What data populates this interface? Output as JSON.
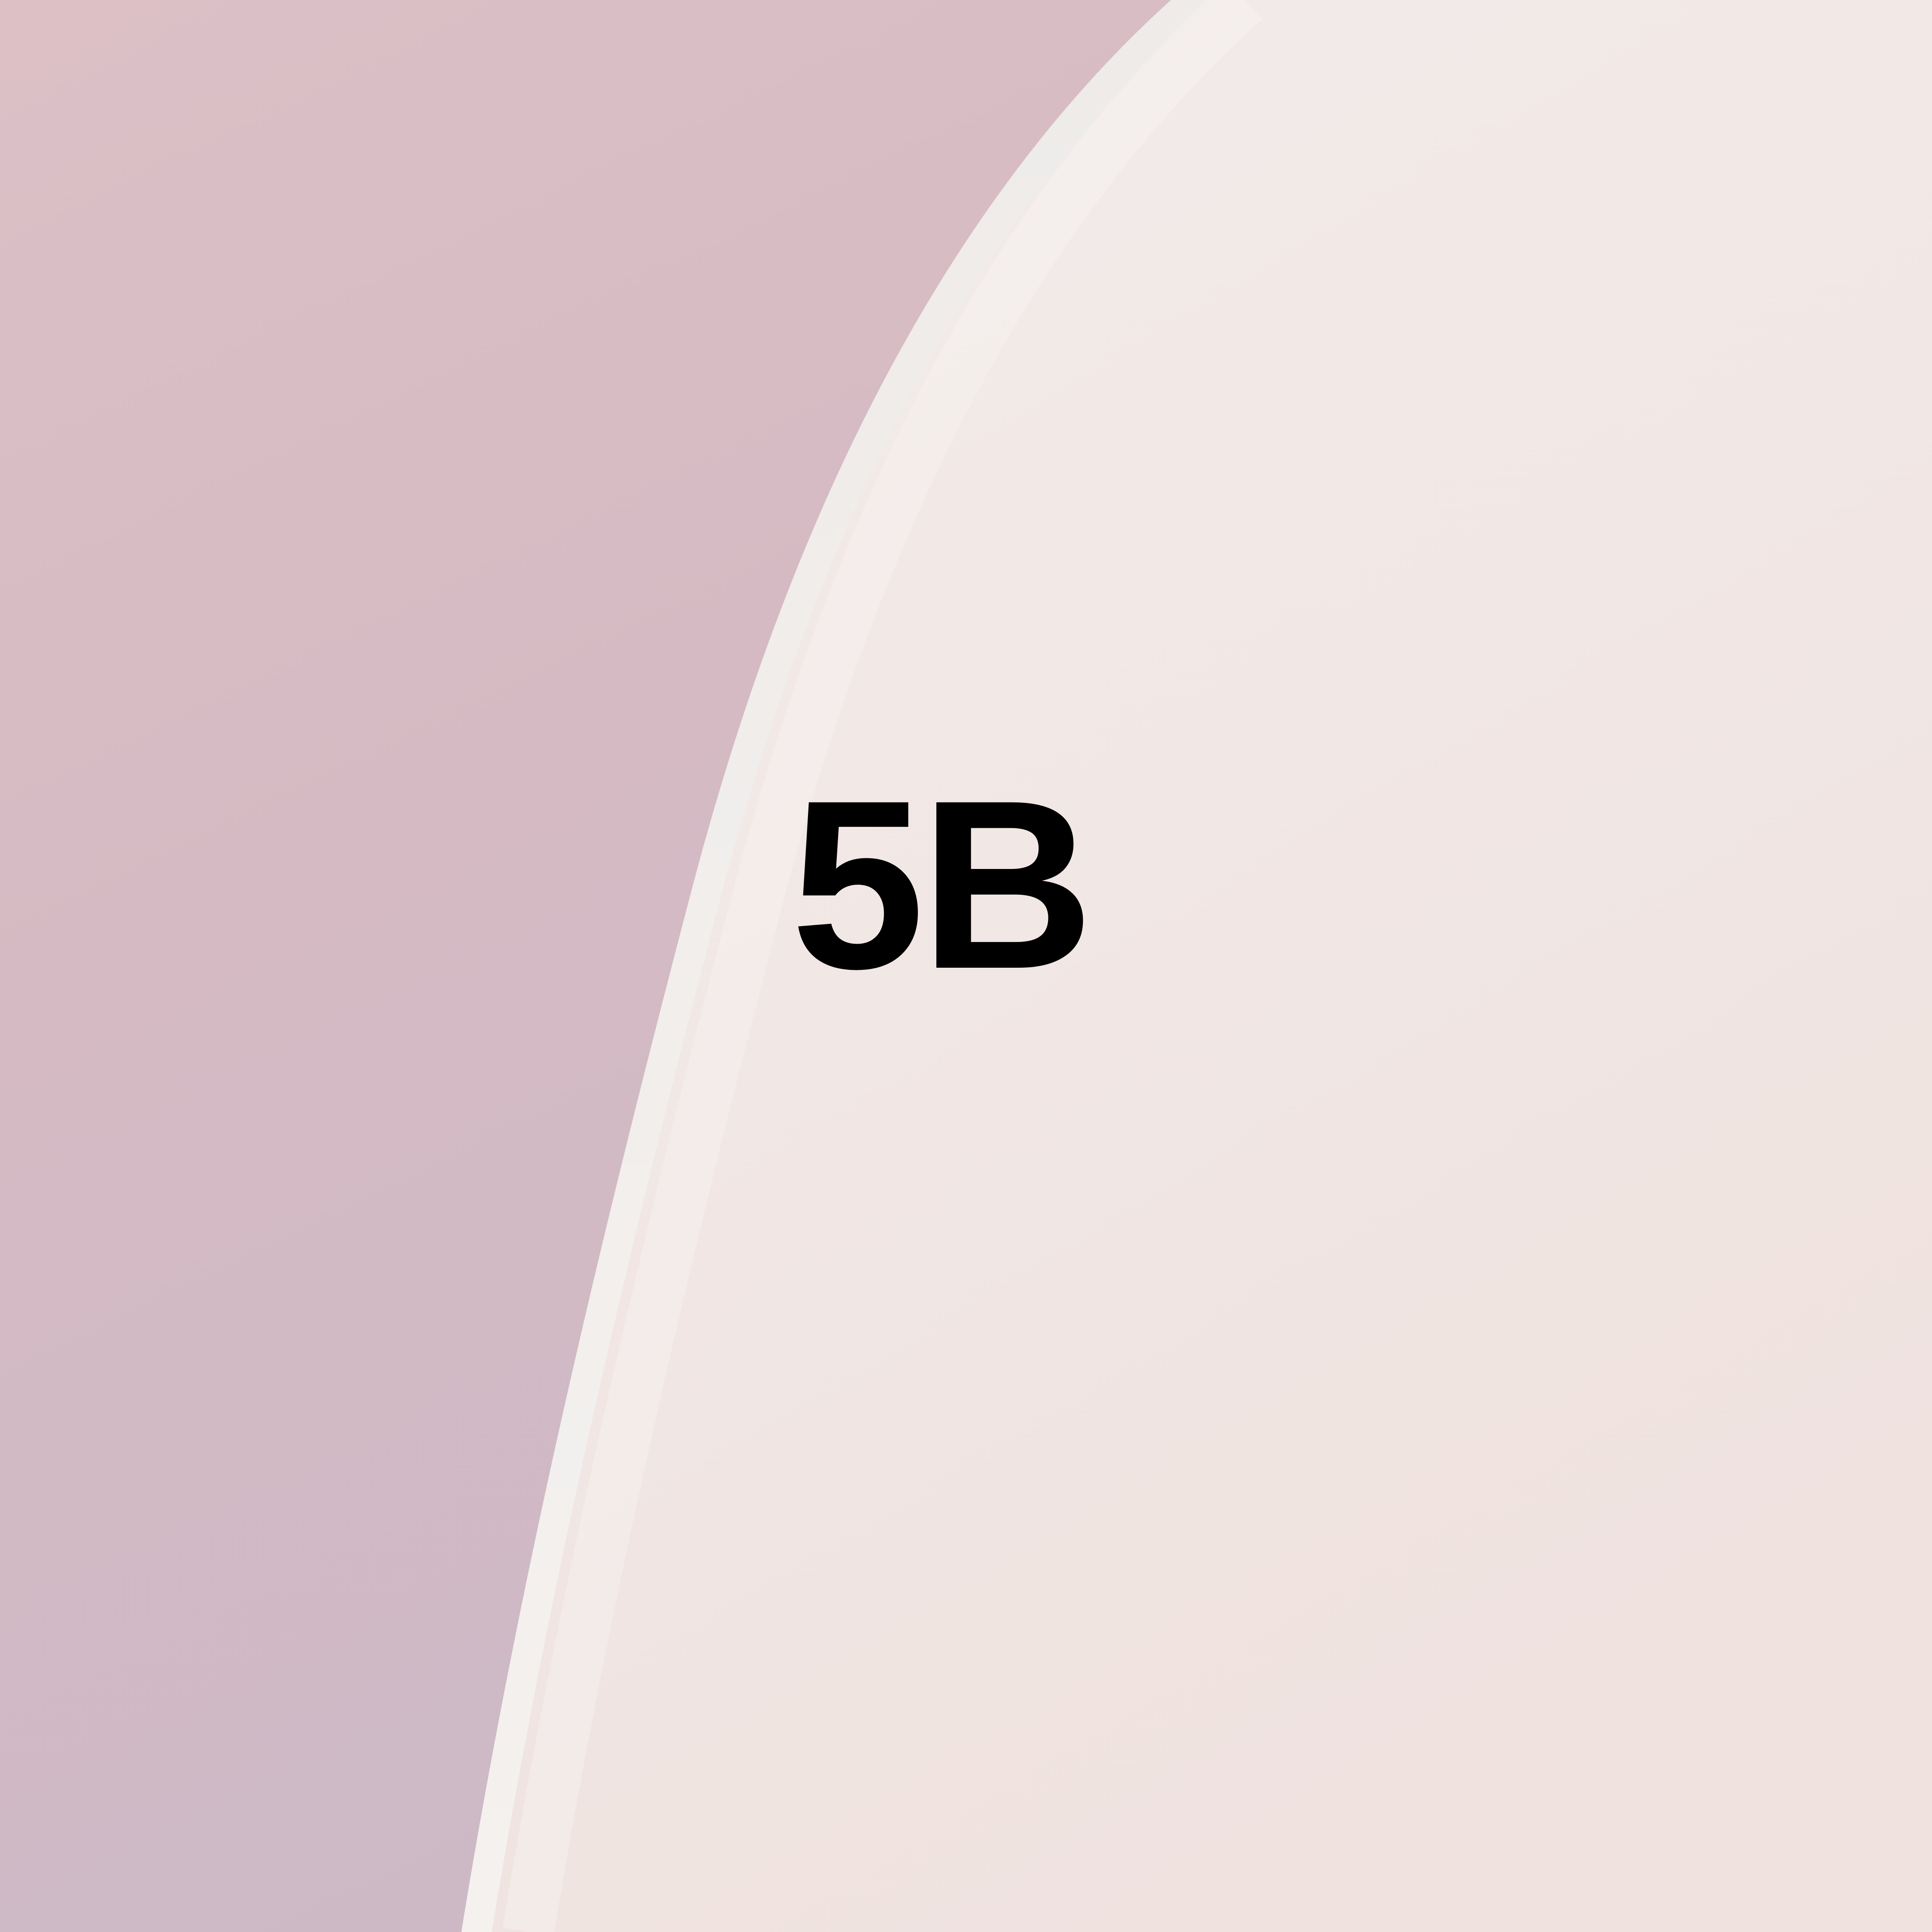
{
  "label": "5B",
  "colors": {
    "pink_panel_top": "#dcc0c6",
    "pink_panel_bottom": "#cdb9c6",
    "cream_panel_top": "#f4eeec",
    "cream_panel_bottom": "#efe2df",
    "highlight_edge": "#f1eeec",
    "text": "#000000"
  }
}
